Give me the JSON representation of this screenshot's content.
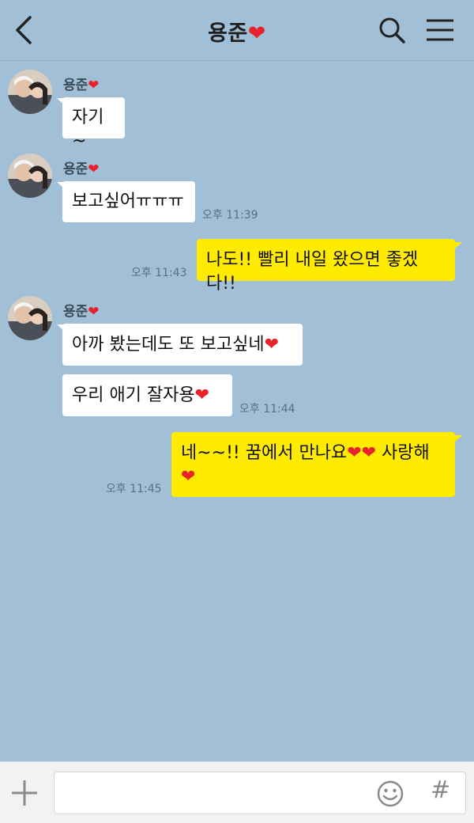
{
  "header": {
    "title": "용준",
    "title_heart": "❤",
    "back_icon": "chevron-left-icon",
    "search_icon": "search-icon",
    "menu_icon": "hamburger-menu-icon"
  },
  "contact": {
    "name": "용준",
    "heart": "❤"
  },
  "messages": [
    {
      "from": "contact",
      "text": "자기~",
      "time": ""
    },
    {
      "from": "contact",
      "text": "보고싶어ㅠㅠㅠ",
      "time": "오후 11:39"
    },
    {
      "from": "me",
      "text": "나도!! 빨리 내일 왔으면 좋겠다!!",
      "time": "오후 11:43"
    },
    {
      "from": "contact",
      "text": "아까 봤는데도 또 보고싶네",
      "heart": "❤",
      "time": ""
    },
    {
      "from": "contact",
      "text": "우리 애기 잘자용",
      "heart": "❤",
      "time": "오후 11:44"
    },
    {
      "from": "me",
      "text_line1": "네~~!! 꿈에서 만나요",
      "hearts": "❤❤",
      "text_line1b": " 사랑해",
      "line2_heart": "❤",
      "time": "오후 11:45"
    }
  ],
  "input": {
    "placeholder": "",
    "plus_icon": "plus-icon",
    "emoji_icon": "emoji-icon",
    "hash_label": "#"
  },
  "colors": {
    "background": "#a1bfd6",
    "incoming_bubble": "#ffffff",
    "outgoing_bubble": "#ffeb00",
    "heart": "#e8222a"
  }
}
